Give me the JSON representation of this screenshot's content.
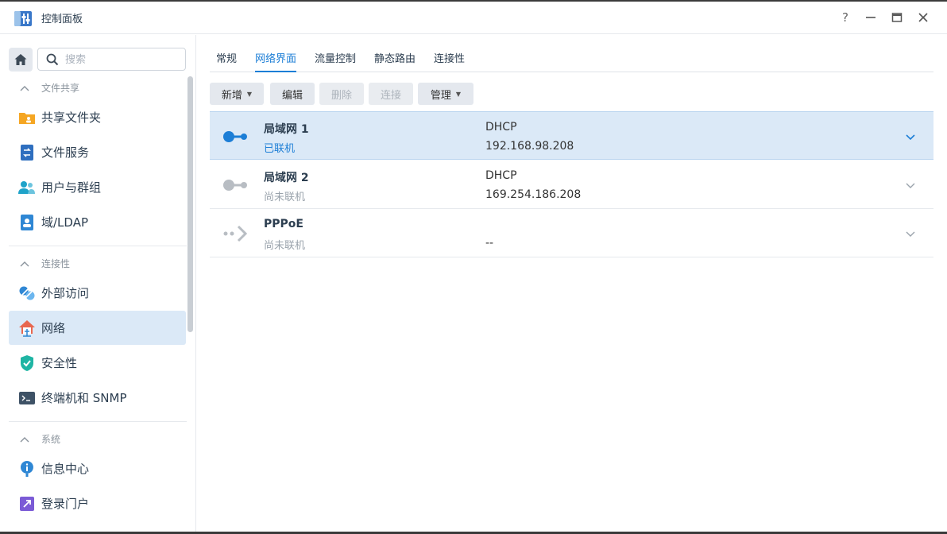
{
  "window": {
    "title": "控制面板",
    "help_label": "?",
    "minimize_label": "—",
    "maximize_label": "□",
    "close_label": "✕"
  },
  "sidebar": {
    "search_placeholder": "搜索",
    "sections": [
      {
        "header": "文件共享",
        "items": [
          {
            "label": "共享文件夹",
            "icon": "folder-share-icon"
          },
          {
            "label": "文件服务",
            "icon": "file-services-icon"
          },
          {
            "label": "用户与群组",
            "icon": "users-groups-icon"
          },
          {
            "label": "域/LDAP",
            "icon": "domain-ldap-icon"
          }
        ]
      },
      {
        "header": "连接性",
        "items": [
          {
            "label": "外部访问",
            "icon": "external-access-icon"
          },
          {
            "label": "网络",
            "icon": "network-house-icon",
            "active": true
          },
          {
            "label": "安全性",
            "icon": "security-shield-icon"
          },
          {
            "label": "终端机和 SNMP",
            "icon": "terminal-icon"
          }
        ]
      },
      {
        "header": "系统",
        "items": [
          {
            "label": "信息中心",
            "icon": "info-center-icon"
          },
          {
            "label": "登录门户",
            "icon": "login-portal-icon"
          }
        ]
      }
    ]
  },
  "tabs": [
    {
      "label": "常规"
    },
    {
      "label": "网络界面",
      "active": true
    },
    {
      "label": "流量控制"
    },
    {
      "label": "静态路由"
    },
    {
      "label": "连接性"
    }
  ],
  "toolbar": {
    "create_label": "新增",
    "edit_label": "编辑",
    "delete_label": "删除",
    "connect_label": "连接",
    "manage_label": "管理"
  },
  "interfaces": [
    {
      "name": "局域网 1",
      "status": "已联机",
      "mode": "DHCP",
      "ip": "192.168.98.208",
      "connected": true
    },
    {
      "name": "局域网 2",
      "status": "尚未联机",
      "mode": "DHCP",
      "ip": "169.254.186.208",
      "connected": false
    },
    {
      "name": "PPPoE",
      "status": "尚未联机",
      "mode": "",
      "ip": "--",
      "connected": false
    }
  ],
  "colors": {
    "accent": "#1c7ed6",
    "selected_row": "#dbe9f7",
    "connected_icon": "#1c7ed6",
    "disconnected_icon": "#b8bdc3"
  }
}
